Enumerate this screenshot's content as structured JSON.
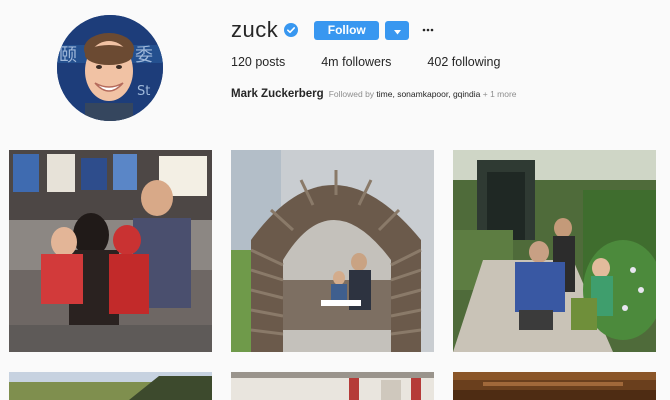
{
  "profile": {
    "username": "zuck",
    "verified": true,
    "follow_label": "Follow",
    "more_label": "···",
    "posts": "120",
    "posts_label": "posts",
    "followers": "4m",
    "followers_label": "followers",
    "following": "402",
    "following_label": "following",
    "full_name": "Mark Zuckerberg",
    "followed_by_prefix": "Followed by",
    "followed_by_names": "time, sonamkapoor, gqindia",
    "followed_by_more": "+ 1 more"
  },
  "colors": {
    "accent": "#3897f0",
    "background": "#fafafa",
    "text": "#262626",
    "muted": "#8e8e8e"
  },
  "posts": [
    {
      "id": "post-1",
      "icon": "family-photo"
    },
    {
      "id": "post-2",
      "icon": "wooden-arch-photo"
    },
    {
      "id": "post-3",
      "icon": "garden-photo"
    },
    {
      "id": "post-4",
      "icon": "landscape-photo"
    },
    {
      "id": "post-5",
      "icon": "office-photo"
    },
    {
      "id": "post-6",
      "icon": "interior-photo"
    }
  ]
}
